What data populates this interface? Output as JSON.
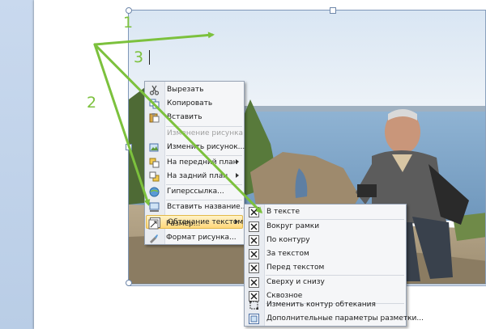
{
  "annotations": {
    "n1": "1",
    "n2": "2",
    "n3": "3"
  },
  "context_menu": {
    "items": [
      {
        "label": "Вырезать",
        "icon": "scissors-icon",
        "enabled": true
      },
      {
        "label": "Копировать",
        "icon": "copy-icon",
        "enabled": true
      },
      {
        "label": "Вставить",
        "icon": "paste-icon",
        "enabled": true
      },
      {
        "label": "Изменение рисунка",
        "icon": "",
        "enabled": false
      },
      {
        "label": "Изменить рисунок...",
        "icon": "change-picture-icon",
        "enabled": true
      },
      {
        "label": "На передний план",
        "icon": "bring-forward-icon",
        "enabled": true,
        "submenu": true
      },
      {
        "label": "На задний план",
        "icon": "send-backward-icon",
        "enabled": true,
        "submenu": true
      },
      {
        "label": "Гиперссылка...",
        "icon": "hyperlink-icon",
        "enabled": true
      },
      {
        "label": "Вставить название...",
        "icon": "insert-caption-icon",
        "enabled": true
      },
      {
        "label": "Обтекание текстом",
        "icon": "text-wrap-icon",
        "enabled": true,
        "submenu": true,
        "highlighted": true
      },
      {
        "label": "Размер...",
        "icon": "size-icon",
        "enabled": true
      },
      {
        "label": "Формат рисунка...",
        "icon": "format-picture-icon",
        "enabled": true
      }
    ]
  },
  "wrap_submenu": {
    "items": [
      {
        "label": "В тексте",
        "icon": "wrap-inline-icon"
      },
      {
        "label": "Вокруг рамки",
        "icon": "wrap-square-icon"
      },
      {
        "label": "По контуру",
        "icon": "wrap-tight-icon"
      },
      {
        "label": "За текстом",
        "icon": "wrap-behind-icon"
      },
      {
        "label": "Перед текстом",
        "icon": "wrap-front-icon"
      },
      {
        "label": "Сверху и снизу",
        "icon": "wrap-top-bottom-icon"
      },
      {
        "label": "Сквозное",
        "icon": "wrap-through-icon"
      },
      {
        "label": "Изменить контур обтекания",
        "icon": "edit-wrap-points-icon"
      },
      {
        "label": "Дополнительные параметры разметки...",
        "icon": "more-layout-options-icon"
      }
    ]
  },
  "colors": {
    "annotation_green": "#7cc13d",
    "menu_highlight": "#ffd77a",
    "menu_bg": "#f5f6f8"
  }
}
